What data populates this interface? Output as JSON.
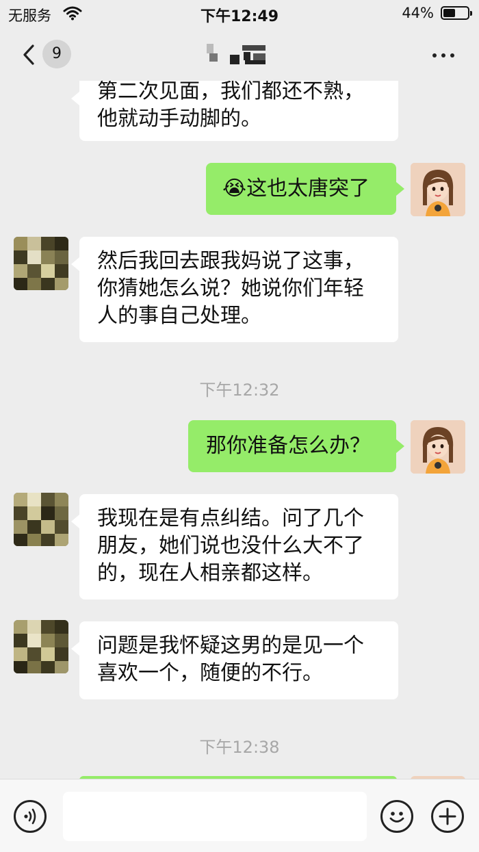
{
  "status_bar": {
    "carrier": "无服务",
    "time": "下午12:49",
    "battery": "44%",
    "icons": [
      "wifi-icon",
      "battery-icon"
    ]
  },
  "nav": {
    "unread_count": "9",
    "icons": [
      "chevron-left-icon",
      "more-horizontal-icon"
    ]
  },
  "messages": [
    {
      "side": "in",
      "text": "第二次见面，我们都还不熟，他就动手动脚的。"
    },
    {
      "side": "out",
      "emoji": "😭",
      "text": "这也太唐突了"
    },
    {
      "side": "in",
      "text": "然后我回去跟我妈说了这事，你猜她怎么说？她说你们年轻人的事自己处理。"
    },
    {
      "type": "time",
      "text": "下午12:32"
    },
    {
      "side": "out",
      "text": "那你准备怎么办？"
    },
    {
      "side": "in",
      "text": "我现在是有点纠结。问了几个朋友，她们说也没什么大不了的，现在人相亲都这样。"
    },
    {
      "side": "in",
      "text": "问题是我怀疑这男的是见一个喜欢一个，随便的不行。"
    },
    {
      "type": "time",
      "text": "下午12:38"
    }
  ],
  "input_bar": {
    "icons": [
      "voice-icon",
      "emoji-icon",
      "plus-icon"
    ]
  },
  "colors": {
    "background": "#ededed",
    "outgoing_bubble": "#95ec69",
    "incoming_bubble": "#ffffff",
    "timestamp": "#a7a7a7"
  }
}
